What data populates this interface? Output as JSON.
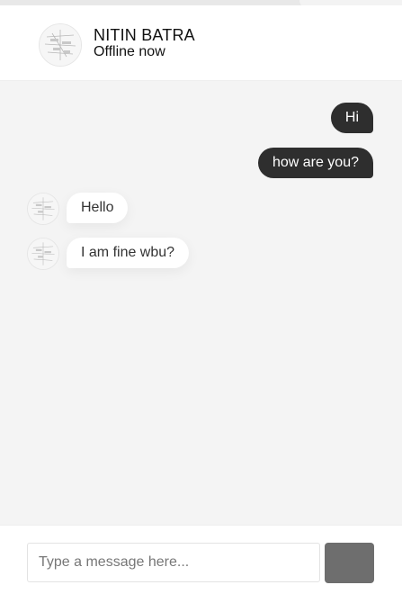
{
  "header": {
    "contact_name": "NITIN BATRA",
    "status": "Offline now"
  },
  "messages": [
    {
      "direction": "sent",
      "text": "Hi"
    },
    {
      "direction": "sent",
      "text": "how are you?"
    },
    {
      "direction": "received",
      "text": "Hello"
    },
    {
      "direction": "received",
      "text": "I am fine wbu?"
    }
  ],
  "composer": {
    "input_value": "",
    "placeholder": "Type a message here..."
  },
  "icons": {
    "avatar": "profile-avatar-icon"
  },
  "colors": {
    "sent_bubble": "#2e2e2e",
    "received_bubble": "#ffffff",
    "chat_background": "#f4f4f4",
    "send_button": "#6e6e6e"
  }
}
